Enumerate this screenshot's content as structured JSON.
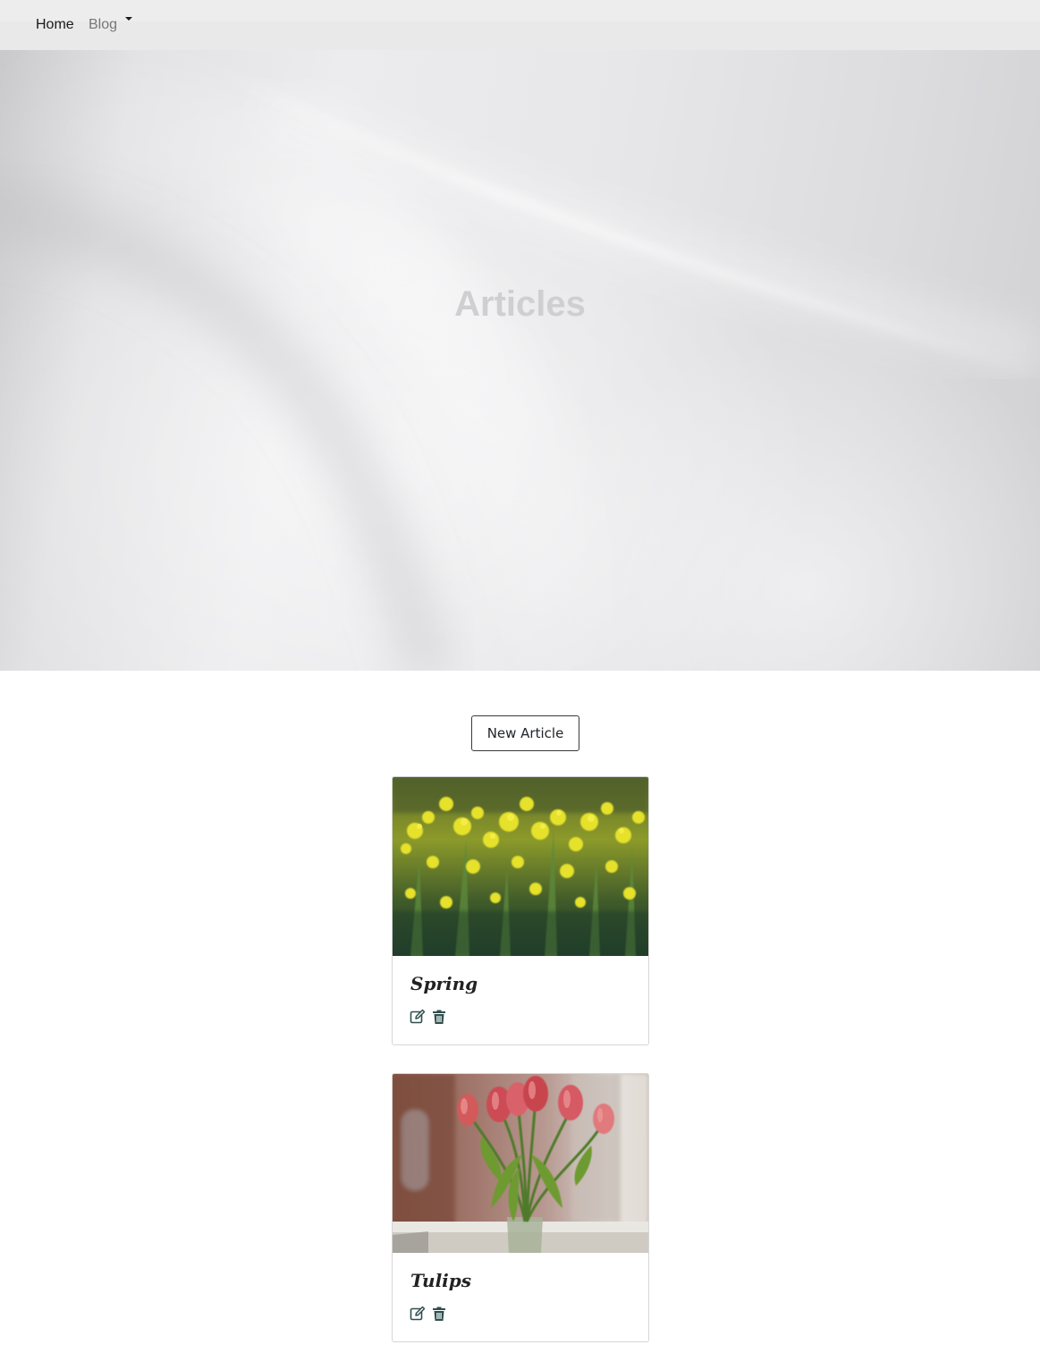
{
  "nav": {
    "home_label": "Home",
    "blog_label": "Blog"
  },
  "hero": {
    "title": "Articles"
  },
  "actions": {
    "new_article_label": "New Article"
  },
  "articles": [
    {
      "title": "Spring",
      "image": "yellow-rapeseed-flowers",
      "edit_icon": "edit-icon",
      "delete_icon": "trash-icon"
    },
    {
      "title": "Tulips",
      "image": "red-tulips-in-vase",
      "edit_icon": "edit-icon",
      "delete_icon": "trash-icon"
    }
  ],
  "colors": {
    "icon_color": "#2f4f4f",
    "text_dark": "#212529",
    "nav_muted": "#777777"
  }
}
